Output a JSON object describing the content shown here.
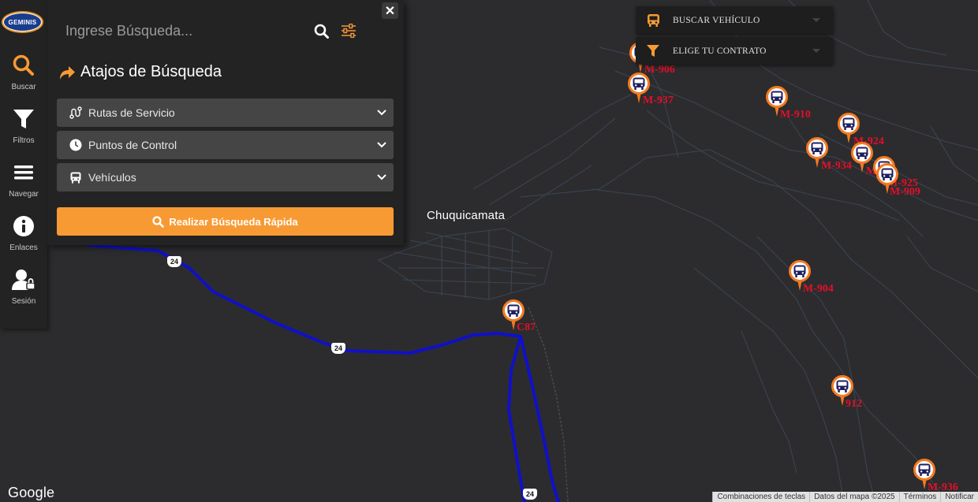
{
  "map": {
    "city_label": "Chuquicamata",
    "route_number": "24",
    "google_logo": "Google",
    "attribution": [
      "Combinaciones de teclas",
      "Datos del mapa ©2025",
      "Términos",
      "Notificar"
    ],
    "colors": {
      "background": "#2c2c2e",
      "road": "#3f4a5a",
      "route": "#1010c8",
      "marker_border": "#f47a20",
      "marker_label": "#e3102a"
    },
    "markers": [
      {
        "label": "M-906",
        "icon": "bus-icon"
      },
      {
        "label": "M-937",
        "icon": "bus-icon"
      },
      {
        "label": "M-910",
        "icon": "bus-icon"
      },
      {
        "label": "M-924",
        "icon": "bus-icon"
      },
      {
        "label": "M-934",
        "icon": "bus-icon"
      },
      {
        "label": "M",
        "icon": "bus-icon"
      },
      {
        "label": "M-925",
        "icon": "bus-icon"
      },
      {
        "label": "M-909",
        "icon": "bus-icon"
      },
      {
        "label": "M-904",
        "icon": "bus-icon"
      },
      {
        "label": "C87",
        "icon": "bus-icon"
      },
      {
        "label": "912",
        "icon": "bus-icon"
      },
      {
        "label": "M-936",
        "icon": "bus-icon"
      }
    ]
  },
  "toolbar": {
    "logo_text": "GEMINIS",
    "items": [
      {
        "label": "Buscar",
        "icon": "search-icon"
      },
      {
        "label": "Filtros",
        "icon": "filter-icon"
      },
      {
        "label": "Navegar",
        "icon": "menu-icon"
      },
      {
        "label": "Enlaces",
        "icon": "info-icon"
      },
      {
        "label": "Sesión",
        "icon": "user-lock-icon"
      }
    ]
  },
  "search": {
    "placeholder": "Ingrese Búsqueda...",
    "value": "",
    "section_title": "Atajos de Búsqueda",
    "accordions": [
      {
        "label": "Rutas de Servicio",
        "icon": "route-icon"
      },
      {
        "label": "Puntos de Control",
        "icon": "clock-icon"
      },
      {
        "label": "Vehículos",
        "icon": "bus-icon"
      }
    ],
    "quick_button": "Realizar Búsqueda Rápida",
    "close": "✕"
  },
  "dropdowns": {
    "vehicle": "BUSCAR VEHÍCULO",
    "contract": "ELIGE TU CONTRATO"
  },
  "accent": "#f89a34"
}
